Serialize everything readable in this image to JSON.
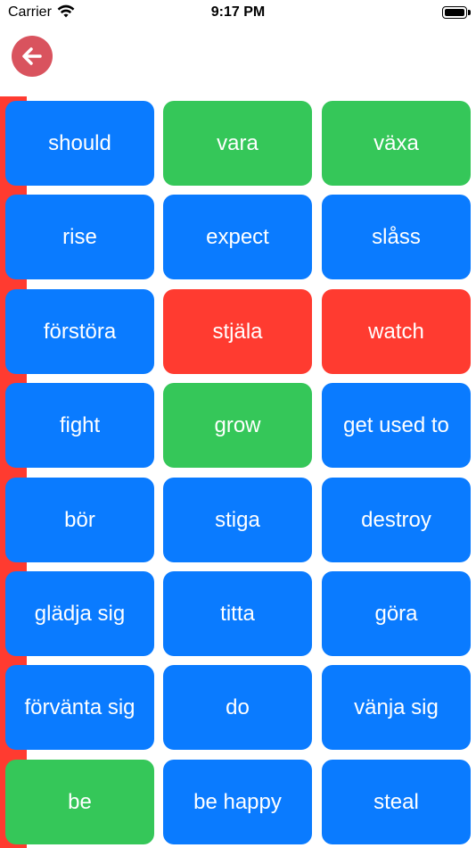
{
  "status_bar": {
    "carrier": "Carrier",
    "time": "9:17 PM"
  },
  "colors": {
    "blue": "#0a7bff",
    "green": "#35c759",
    "red": "#ff3b30",
    "back_button": "#d9535e",
    "strip": "#ff3b30"
  },
  "icons": {
    "back": "arrow-left-icon",
    "wifi": "wifi-icon",
    "battery": "battery-icon"
  },
  "tiles": [
    {
      "label": "should",
      "color": "blue"
    },
    {
      "label": "vara",
      "color": "green"
    },
    {
      "label": "växa",
      "color": "green"
    },
    {
      "label": "rise",
      "color": "blue"
    },
    {
      "label": "expect",
      "color": "blue"
    },
    {
      "label": "slåss",
      "color": "blue"
    },
    {
      "label": "förstöra",
      "color": "blue"
    },
    {
      "label": "stjäla",
      "color": "red"
    },
    {
      "label": "watch",
      "color": "red"
    },
    {
      "label": "fight",
      "color": "blue"
    },
    {
      "label": "grow",
      "color": "green"
    },
    {
      "label": "get used to",
      "color": "blue"
    },
    {
      "label": "bör",
      "color": "blue"
    },
    {
      "label": "stiga",
      "color": "blue"
    },
    {
      "label": "destroy",
      "color": "blue"
    },
    {
      "label": "glädja sig",
      "color": "blue"
    },
    {
      "label": "titta",
      "color": "blue"
    },
    {
      "label": "göra",
      "color": "blue"
    },
    {
      "label": "förvänta sig",
      "color": "blue"
    },
    {
      "label": "do",
      "color": "blue"
    },
    {
      "label": "vänja sig",
      "color": "blue"
    },
    {
      "label": "be",
      "color": "green"
    },
    {
      "label": "be happy",
      "color": "blue"
    },
    {
      "label": "steal",
      "color": "blue"
    }
  ]
}
